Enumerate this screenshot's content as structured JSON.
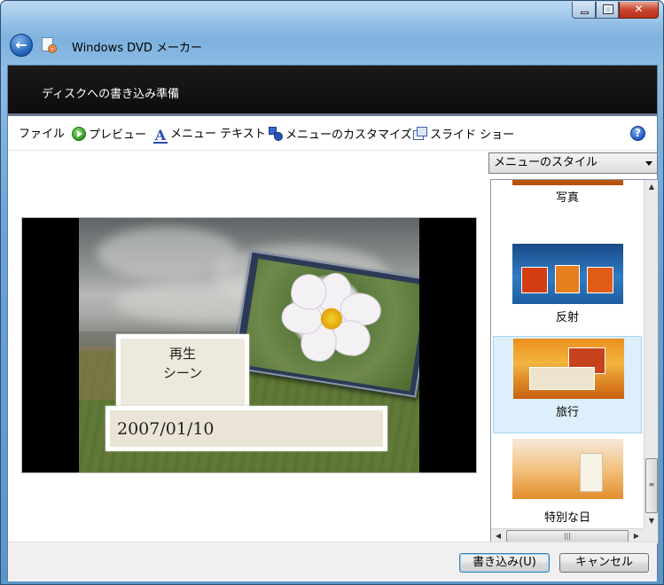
{
  "window": {
    "title": "Windows DVD メーカー"
  },
  "header": {
    "title": "ディスクへの書き込み準備"
  },
  "toolbar": {
    "file_label": "ファイル",
    "preview_label": "プレビュー",
    "menu_text_label": "メニュー テキスト",
    "customize_label": "メニューのカスタマイズ",
    "slideshow_label": "スライド ショー",
    "help_icon": "help-icon"
  },
  "preview": {
    "line1": "再生",
    "line2": "シーン",
    "date": "2007/01/10"
  },
  "style_panel": {
    "dropdown_value": "メニューのスタイル",
    "items": [
      {
        "label": "写真",
        "selected": false
      },
      {
        "label": "反射",
        "selected": false
      },
      {
        "label": "旅行",
        "selected": true
      },
      {
        "label": "特別な日",
        "selected": false
      }
    ]
  },
  "footer": {
    "burn_label": "書き込み(U)",
    "cancel_label": "キャンセル"
  }
}
